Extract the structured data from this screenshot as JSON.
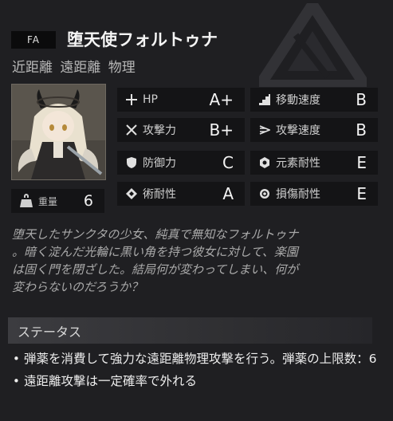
{
  "operator": {
    "code": "FA",
    "name": "堕天使フォルトゥナ",
    "tags": "近距離 遠距離 物理",
    "weight_label": "重量",
    "weight_value": "6"
  },
  "stats": [
    {
      "key": "hp",
      "label": "HP",
      "grade": "A+",
      "icon": "plus-icon"
    },
    {
      "key": "move_speed",
      "label": "移動速度",
      "grade": "B",
      "icon": "stairs-icon"
    },
    {
      "key": "attack",
      "label": "攻撃力",
      "grade": "B+",
      "icon": "crossed-swords-icon"
    },
    {
      "key": "attack_speed",
      "label": "攻撃速度",
      "grade": "B",
      "icon": "speed-icon"
    },
    {
      "key": "defense",
      "label": "防御力",
      "grade": "C",
      "icon": "shield-icon"
    },
    {
      "key": "element_res",
      "label": "元素耐性",
      "grade": "E",
      "icon": "element-icon"
    },
    {
      "key": "arts_res",
      "label": "術耐性",
      "grade": "A",
      "icon": "diamond-icon"
    },
    {
      "key": "damage_res",
      "label": "損傷耐性",
      "grade": "E",
      "icon": "ring-icon"
    }
  ],
  "description_lines": [
    "堕天したサンクタの少女、純真で無知なフォルトゥナ",
    "。暗く淀んだ光輪に黒い角を持つ彼女に対して、楽園",
    "は固く門を閉ざした。結局何が変わってしまい、何が",
    "変わらないのだろうか？"
  ],
  "status": {
    "title": "ステータス",
    "traits": [
      "弾薬を消費して強力な遠距離物理攻撃を行う。弾薬の上限数：6",
      "遠距離攻撃は一定確率で外れる"
    ]
  },
  "colors": {
    "background": "#1f1f22",
    "panel": "#141416",
    "text": "#e8e8e8",
    "muted": "#a9a9a9"
  }
}
